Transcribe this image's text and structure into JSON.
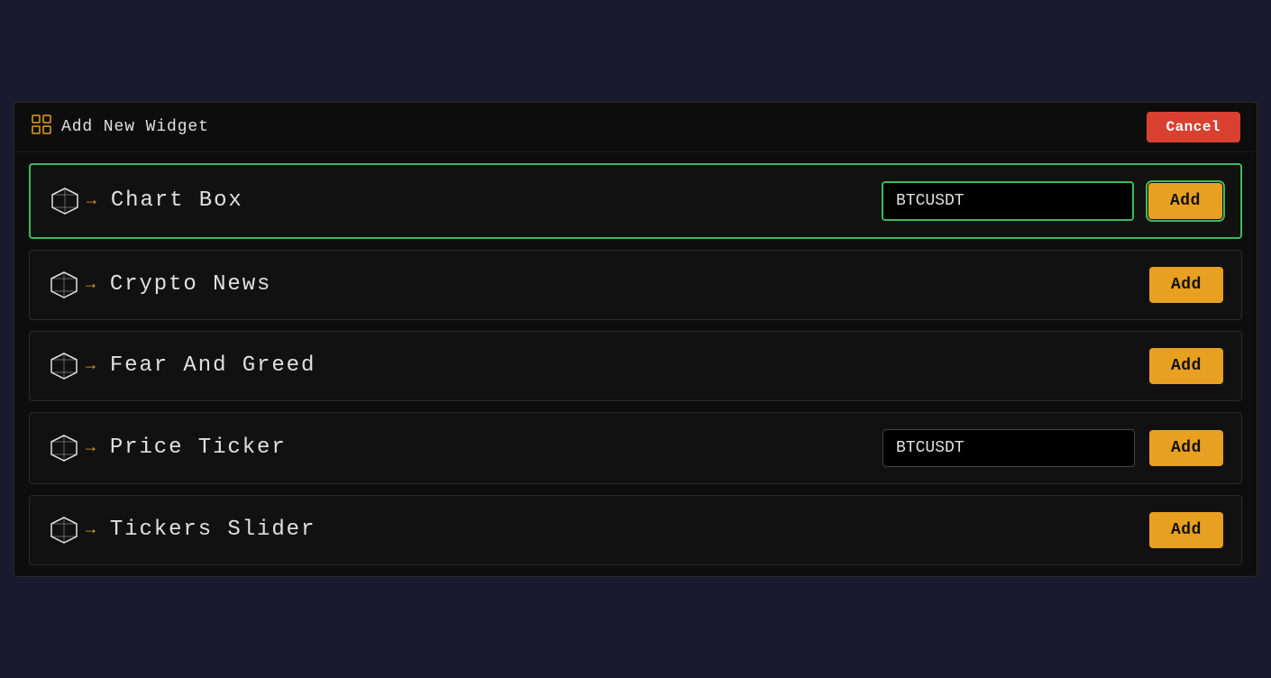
{
  "header": {
    "icon": "widget-icon",
    "title": "Add New Widget",
    "cancel_label": "Cancel"
  },
  "widgets": [
    {
      "id": "chart-box",
      "name": "Chart Box",
      "has_input": true,
      "input_value": "BTCUSDT",
      "input_placeholder": "BTCUSDT",
      "add_label": "Add",
      "selected": true
    },
    {
      "id": "crypto-news",
      "name": "Crypto News",
      "has_input": false,
      "input_value": "",
      "input_placeholder": "",
      "add_label": "Add",
      "selected": false
    },
    {
      "id": "fear-and-greed",
      "name": "Fear And Greed",
      "has_input": false,
      "input_value": "",
      "input_placeholder": "",
      "add_label": "Add",
      "selected": false
    },
    {
      "id": "price-ticker",
      "name": "Price Ticker",
      "has_input": true,
      "input_value": "BTCUSDT",
      "input_placeholder": "BTCUSDT",
      "add_label": "Add",
      "selected": false
    },
    {
      "id": "tickers-slider",
      "name": "Tickers Slider",
      "has_input": false,
      "input_value": "",
      "input_placeholder": "",
      "add_label": "Add",
      "selected": false
    }
  ],
  "colors": {
    "accent_orange": "#e8a020",
    "accent_green": "#3dba5a",
    "cancel_red": "#d94030"
  }
}
